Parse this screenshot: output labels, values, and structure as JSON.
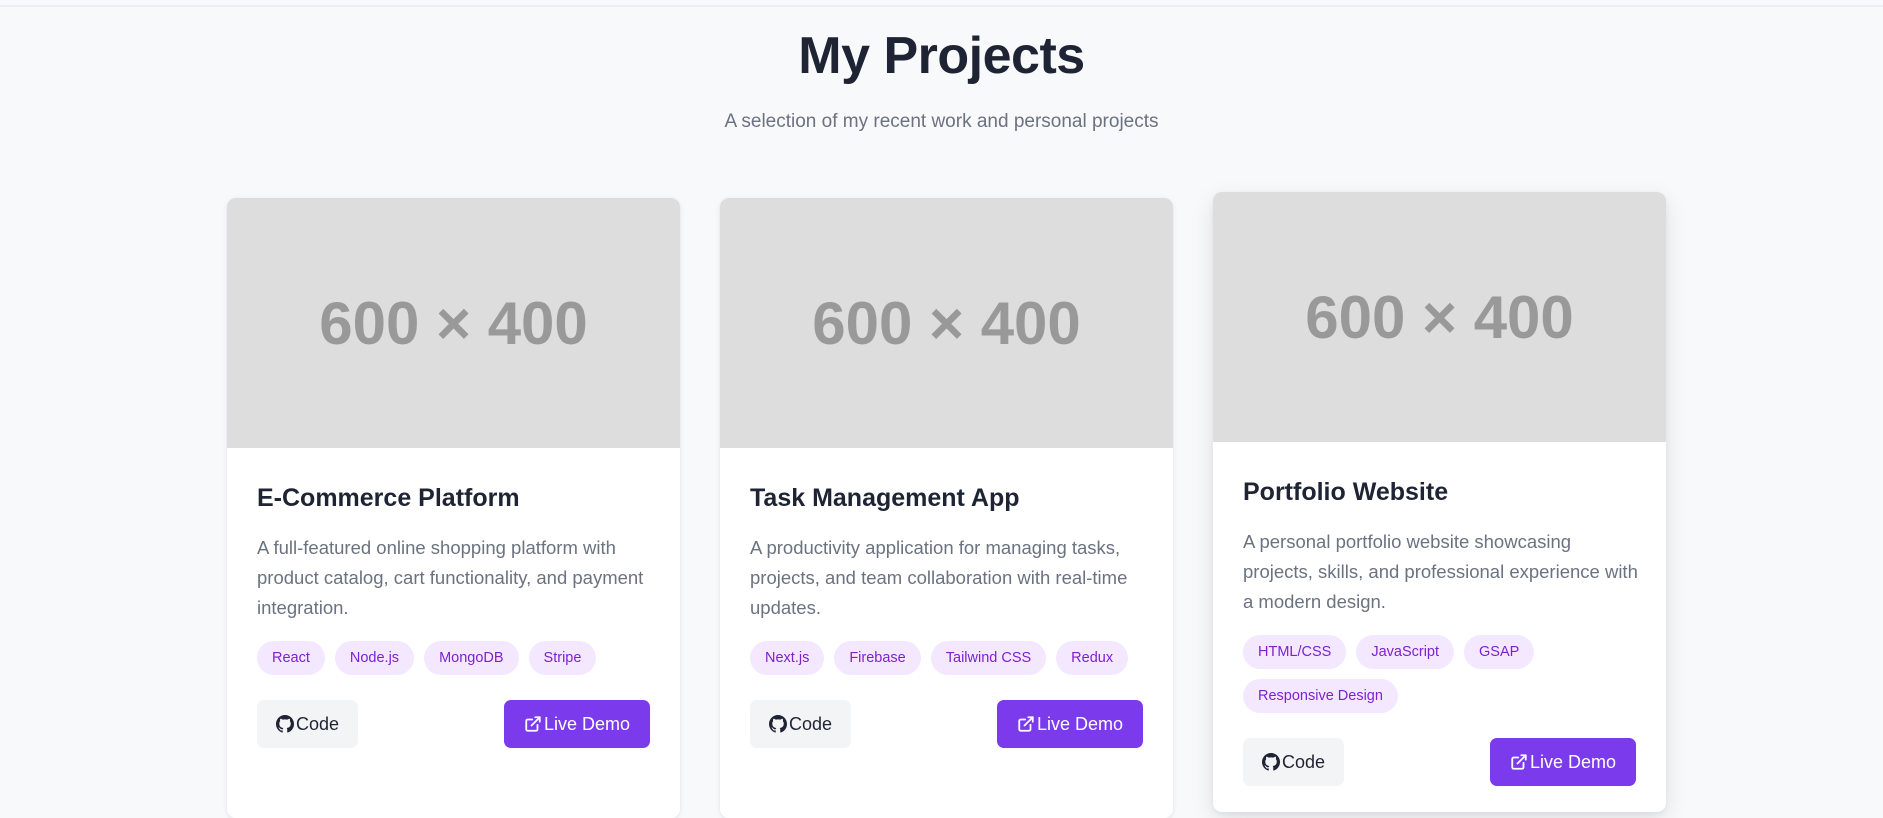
{
  "header": {
    "title": "My Projects",
    "subtitle": "A selection of my recent work and personal projects"
  },
  "projects": [
    {
      "image_placeholder": "600 × 400",
      "title": "E-Commerce Platform",
      "description": "A full-featured online shopping platform with product catalog, cart functionality, and payment integration.",
      "tags": [
        "React",
        "Node.js",
        "MongoDB",
        "Stripe"
      ],
      "code_label": "Code",
      "demo_label": "Live Demo"
    },
    {
      "image_placeholder": "600 × 400",
      "title": "Task Management App",
      "description": "A productivity application for managing tasks, projects, and team collaboration with real-time updates.",
      "tags": [
        "Next.js",
        "Firebase",
        "Tailwind CSS",
        "Redux"
      ],
      "code_label": "Code",
      "demo_label": "Live Demo"
    },
    {
      "image_placeholder": "600 × 400",
      "title": "Portfolio Website",
      "description": "A personal portfolio website showcasing projects, skills, and professional experience with a modern design.",
      "tags": [
        "HTML/CSS",
        "JavaScript",
        "GSAP",
        "Responsive Design"
      ],
      "code_label": "Code",
      "demo_label": "Live Demo"
    }
  ],
  "colors": {
    "accent": "#7c3aed",
    "tag_bg": "#f3e8ff",
    "tag_text": "#7e22ce",
    "placeholder_bg": "#dddddd"
  },
  "icons": {
    "code_button": "github-icon",
    "demo_button": "external-link-icon"
  }
}
